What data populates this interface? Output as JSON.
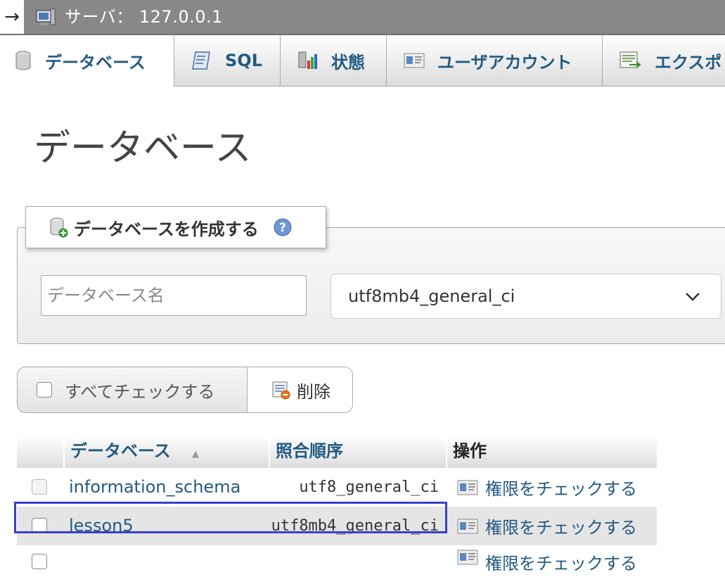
{
  "server_bar": {
    "arrow": "→",
    "title": "サーバ： 127.0.0.1"
  },
  "tabs": [
    {
      "label": "データベース",
      "icon": "database-icon",
      "active": true
    },
    {
      "label": "SQL",
      "icon": "sql-icon",
      "active": false
    },
    {
      "label": "状態",
      "icon": "status-chart-icon",
      "active": false
    },
    {
      "label": "ユーザアカウント",
      "icon": "user-accounts-icon",
      "active": false
    },
    {
      "label": "エクスポ",
      "icon": "export-icon",
      "active": false
    }
  ],
  "page_title": "データベース",
  "create_db": {
    "legend": "データベースを作成する",
    "name_placeholder": "データベース名",
    "collation_selected": "utf8mb4_general_ci"
  },
  "bulk": {
    "check_all_label": "すべてチェックする",
    "delete_label": "削除"
  },
  "table": {
    "columns": [
      "データベース",
      "照合順序",
      "操作"
    ],
    "sort_indicator": "▲",
    "rows": [
      {
        "name": "information_schema",
        "collation": "utf8_general_ci",
        "action": "権限をチェックする"
      },
      {
        "name": "lesson5",
        "collation": "utf8mb4_general_ci",
        "action": "権限をチェックする"
      },
      {
        "name": "",
        "collation": "",
        "action": "権限をチェックする"
      }
    ]
  },
  "colors": {
    "link": "#235a81",
    "highlight_box": "#3a40c8",
    "server_bar": "#888888"
  }
}
